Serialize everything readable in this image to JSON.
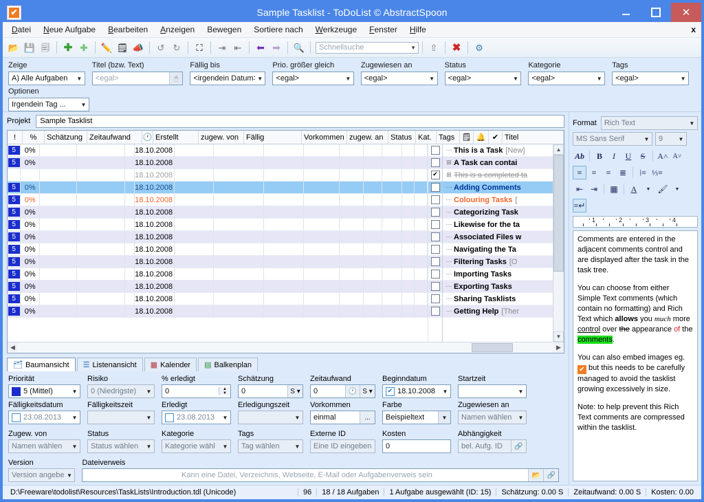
{
  "window": {
    "title": "Sample Tasklist - ToDoList © AbstractSpoon",
    "minimize": "—",
    "maximize": "□",
    "close": "✕"
  },
  "menubar": {
    "items": [
      "Datei",
      "Neue Aufgabe",
      "Bearbeiten",
      "Anzeigen",
      "Bewegen",
      "Sortiere nach",
      "Werkzeuge",
      "Fenster",
      "Hilfe"
    ],
    "close_label": "x"
  },
  "toolbar": {
    "icons": [
      "open-folder-icon",
      "save-icon",
      "copy-icon",
      "add-task-icon",
      "add-subtask-icon",
      "edit-icon",
      "properties-icon",
      "clear-icon",
      "undo-icon",
      "redo-icon",
      "fullscreen-icon",
      "indent-icon",
      "outdent-icon",
      "back-icon",
      "forward-icon",
      "find-icon"
    ],
    "search_placeholder": "Schnellsuche",
    "tail_icons": [
      "sort-icon",
      "delete-icon",
      "preferences-icon"
    ]
  },
  "filters": {
    "zeige": {
      "label": "Zeige",
      "value": "A)   Alle Aufgaben"
    },
    "titel": {
      "label": "Titel (bzw. Text)",
      "placeholder": "<egal>"
    },
    "faellig": {
      "label": "Fällig bis",
      "value": "<irgendein Datum>"
    },
    "prio": {
      "label": "Prio. größer gleich",
      "value": "<egal>"
    },
    "zugewiesen": {
      "label": "Zugewiesen an",
      "value": "<egal>"
    },
    "status": {
      "label": "Status",
      "value": "<egal>"
    },
    "kategorie": {
      "label": "Kategorie",
      "value": "<egal>"
    },
    "tags": {
      "label": "Tags",
      "value": "<egal>"
    },
    "optionen": {
      "label": "Optionen",
      "value": "Irgendein Tag ..."
    }
  },
  "project": {
    "label": "Projekt",
    "value": "Sample Tasklist"
  },
  "tasklist": {
    "columns": [
      "!",
      "%",
      "Schätzung",
      "Zeitaufwand",
      "🕐",
      "Erstellt",
      "zugew. von",
      "Fällig",
      "Vorkommen",
      "zugew. an",
      "Status",
      "Kat.",
      "Tags",
      "📑",
      "🔔",
      "✔",
      "Titel"
    ],
    "rows": [
      {
        "prio": "5",
        "pct": "0%",
        "created": "18.10.2008",
        "title": "This is a Task",
        "suffix": "[New]",
        "style": "normal",
        "checked": false
      },
      {
        "prio": "5",
        "pct": "0%",
        "created": "18.10.2008",
        "title": "A Task can contai",
        "suffix": "",
        "style": "normal",
        "checked": false,
        "expander": "+"
      },
      {
        "prio": "",
        "pct": "",
        "created": "18.10.2008",
        "title": "This is a completed ta",
        "suffix": "",
        "style": "done",
        "checked": true,
        "expander": "+"
      },
      {
        "prio": "5",
        "pct": "0%",
        "created": "18.10.2008",
        "title": "Adding Comments",
        "suffix": "",
        "style": "selected",
        "checked": false
      },
      {
        "prio": "5",
        "pct": "0%",
        "created": "18.10.2008",
        "title": "Colouring Tasks",
        "suffix": "[",
        "style": "orange",
        "checked": false
      },
      {
        "prio": "5",
        "pct": "0%",
        "created": "18.10.2008",
        "title": "Categorizing Task",
        "suffix": "",
        "style": "normal",
        "checked": false
      },
      {
        "prio": "5",
        "pct": "0%",
        "created": "18.10.2008",
        "title": "Likewise for the ta",
        "suffix": "",
        "style": "normal",
        "checked": false
      },
      {
        "prio": "5",
        "pct": "0%",
        "created": "18.10.2008",
        "title": "Associated Files w",
        "suffix": "",
        "style": "normal",
        "checked": false
      },
      {
        "prio": "5",
        "pct": "0%",
        "created": "18.10.2008",
        "title": "Navigating the Ta",
        "suffix": "",
        "style": "normal",
        "checked": false
      },
      {
        "prio": "5",
        "pct": "0%",
        "created": "18.10.2008",
        "title": "Filtering Tasks",
        "suffix": "[O",
        "style": "normal",
        "checked": false
      },
      {
        "prio": "5",
        "pct": "0%",
        "created": "18.10.2008",
        "title": "Importing Tasks",
        "suffix": "",
        "style": "normal",
        "checked": false
      },
      {
        "prio": "5",
        "pct": "0%",
        "created": "18.10.2008",
        "title": "Exporting Tasks",
        "suffix": "",
        "style": "normal",
        "checked": false
      },
      {
        "prio": "5",
        "pct": "0%",
        "created": "18.10.2008",
        "title": "Sharing Tasklists",
        "suffix": "",
        "style": "normal",
        "checked": false
      },
      {
        "prio": "5",
        "pct": "0%",
        "created": "18.10.2008",
        "title": "Getting Help",
        "suffix": "[Ther",
        "style": "normal",
        "checked": false
      }
    ]
  },
  "viewtabs": [
    {
      "label": "Baumansicht",
      "icon": "tree-view-icon",
      "active": true
    },
    {
      "label": "Listenansicht",
      "icon": "list-view-icon",
      "active": false
    },
    {
      "label": "Kalender",
      "icon": "calendar-icon",
      "active": false
    },
    {
      "label": "Balkenplan",
      "icon": "gantt-icon",
      "active": false
    }
  ],
  "attributes": {
    "prioritaet": {
      "label": "Priorität",
      "value": "5 (Mittel)",
      "color": "#1b2ecd"
    },
    "risiko": {
      "label": "Risiko",
      "value": "0 (Niedrigste)"
    },
    "prozent": {
      "label": "% erledigt",
      "value": "0"
    },
    "schaetzung": {
      "label": "Schätzung",
      "value": "0",
      "unit": "S"
    },
    "zeitaufwand": {
      "label": "Zeitaufwand",
      "value": "0",
      "unit": "S"
    },
    "beginndatum": {
      "label": "Beginndatum",
      "value": "18.10.2008",
      "checked": true
    },
    "startzeit": {
      "label": "Startzeit",
      "value": ""
    },
    "faelligkeitsdatum": {
      "label": "Fälligkeitsdatum",
      "value": "23.08.2013",
      "checked": false
    },
    "faelligkeitszeit": {
      "label": "Fälligkeitszeit",
      "value": ""
    },
    "erledigt": {
      "label": "Erledigt",
      "value": "23.08.2013",
      "checked": false
    },
    "erledigungszeit": {
      "label": "Erledigungszeit",
      "value": ""
    },
    "vorkommen": {
      "label": "Vorkommen",
      "value": "einmal",
      "button": "..."
    },
    "farbe": {
      "label": "Farbe",
      "value": "Beispieltext"
    },
    "zugewiesen_an": {
      "label": "Zugewiesen an",
      "placeholder": "Namen wählen"
    },
    "zugew_von": {
      "label": "Zugew. von",
      "placeholder": "Namen wählen"
    },
    "status": {
      "label": "Status",
      "placeholder": "Status wählen"
    },
    "kategorie": {
      "label": "Kategorie",
      "placeholder": "Kategorie wähl"
    },
    "tags": {
      "label": "Tags",
      "placeholder": "Tag wählen"
    },
    "externe_id": {
      "label": "Externe ID",
      "placeholder": "Eine ID eingeben"
    },
    "kosten": {
      "label": "Kosten",
      "value": "0"
    },
    "abhaengigkeit": {
      "label": "Abhängigkeit",
      "placeholder": "bel. Aufg. ID"
    },
    "version": {
      "label": "Version",
      "placeholder": "Version angebe"
    },
    "dateiverweis": {
      "label": "Dateiverweis",
      "placeholder": "Kann eine Datei, Verzeichnis, Webseite, E-Mail oder Aufgabenverweis sein"
    }
  },
  "comments": {
    "format_label": "Format",
    "format_value": "Rich Text",
    "font_name": "MS Sans Serif",
    "font_size": "9",
    "ruler_marks": [
      "1",
      "2",
      "3",
      "4"
    ],
    "toolbar_buttons": [
      "spelling-icon",
      "bold-icon",
      "italic-icon",
      "underline-icon",
      "strikethrough-icon",
      "increase-font-icon",
      "decrease-font-icon",
      "align-left-icon",
      "align-center-icon",
      "align-right-icon",
      "align-justify-icon",
      "bullet-list-icon",
      "numbered-list-icon",
      "decrease-indent-icon",
      "increase-indent-icon",
      "table-icon",
      "font-color-icon",
      "font-color-dropdown-icon",
      "highlight-color-icon",
      "highlight-color-dropdown-icon",
      "wordwrap-icon"
    ],
    "paragraphs": {
      "p1": "Comments are entered in the adjacent comments control and are displayed after the task in the task tree.",
      "p2_a": "You can choose from either Simple Text comments (which contain no formatting) and Rich Text which ",
      "p2_allows": "allows",
      "p2_b": " you ",
      "p2_much": "much",
      "p2_c": " more ",
      "p2_control": "control",
      "p2_d": " over ",
      "p2_the": "the",
      "p2_e": " appearance ",
      "p2_of": "of",
      "p2_f": " the ",
      "p2_comments": "comments",
      "p2_g": ".",
      "p3_a": "You can also embed images eg. ",
      "p3_b": " but this needs to be carefully managed to avoid the tasklist growing excessively in size.",
      "p4": "Note: to help prevent this Rich Text comments are compressed within the tasklist."
    }
  },
  "statusbar": {
    "path": "D:\\Freeware\\todolist\\Resources\\TaskLists\\Introduction.tdl (Unicode)",
    "count": "96",
    "tasks": "18 / 18 Aufgaben",
    "selected": "1 Aufgabe ausgewählt (ID: 15)",
    "estimate": "Schätzung: 0.00 S",
    "spent": "Zeitaufwand: 0.00 S",
    "cost": "Kosten: 0.00"
  }
}
